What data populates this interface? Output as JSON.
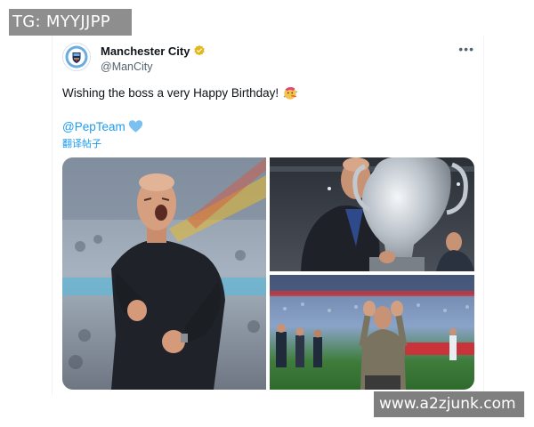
{
  "watermark_top_left": "TG: MYYJJPP",
  "watermark_bottom_right": "www.a2zjunk.com",
  "tweet": {
    "author_name": "Manchester City",
    "author_handle": "@ManCity",
    "text": "Wishing the boss a very Happy Birthday!",
    "party_emoji": "🥳",
    "mention": "@PepTeam",
    "translate_label": "翻译帖子",
    "more_icon": "•••"
  },
  "colors": {
    "link": "#1d9bf0",
    "verified": "#e2b719",
    "heart": "#7cc0ef",
    "city_blue": "#6cabdd"
  },
  "icons": [
    "avatar-logo",
    "verified-badge-icon",
    "more-options-icon",
    "party-popper-icon",
    "blue-heart-icon"
  ]
}
